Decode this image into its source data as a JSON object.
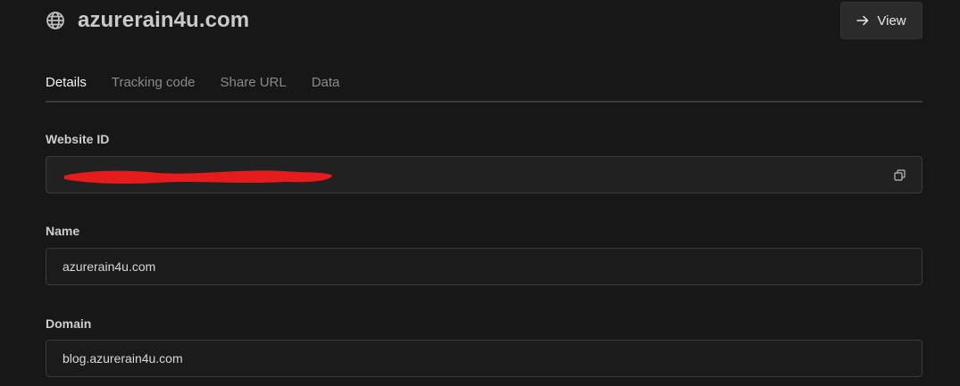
{
  "header": {
    "title": "azurerain4u.com",
    "view_label": "View",
    "icons": {
      "site": "globe-icon",
      "view": "arrow-right-icon"
    }
  },
  "tabs": [
    {
      "label": "Details",
      "active": true
    },
    {
      "label": "Tracking code",
      "active": false
    },
    {
      "label": "Share URL",
      "active": false
    },
    {
      "label": "Data",
      "active": false
    }
  ],
  "fields": {
    "website_id": {
      "label": "Website ID",
      "value": "",
      "redacted": true,
      "copy_icon": "copy-icon"
    },
    "name": {
      "label": "Name",
      "value": "azurerain4u.com"
    },
    "domain": {
      "label": "Domain",
      "value": "blog.azurerain4u.com"
    }
  },
  "colors": {
    "background": "#171717",
    "input_background": "#1b1b1b",
    "border": "#3a3a3a",
    "button_background": "#2b2b2b",
    "redaction": "#e61c1c"
  }
}
